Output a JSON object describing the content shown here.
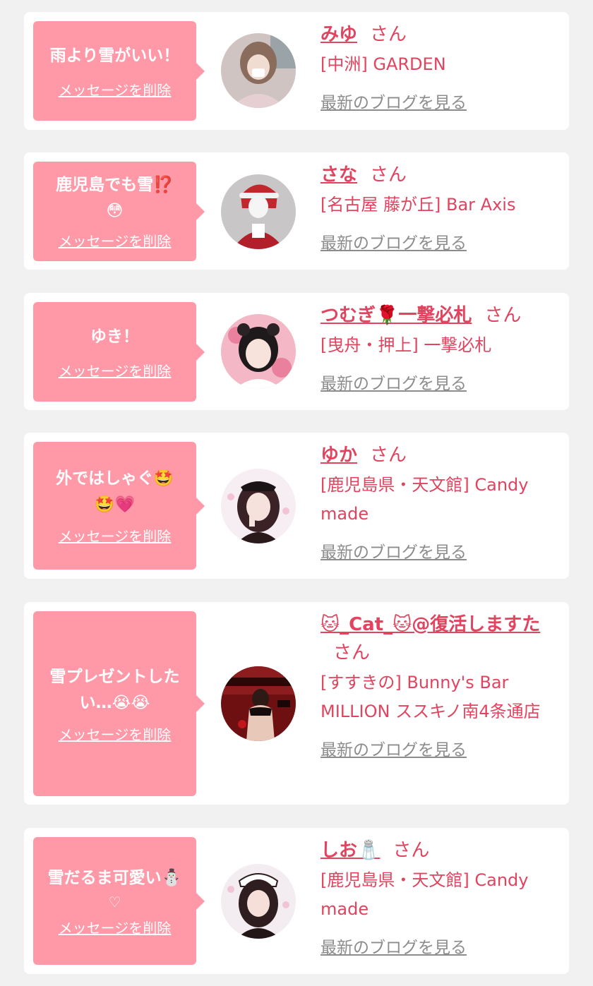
{
  "delete_label": "メッセージを削除",
  "blog_label": "最新のブログを見る",
  "san_suffix": "さん",
  "colors": {
    "background": "#f1f1f1",
    "card": "#ffffff",
    "bubble": "#ff99a8",
    "accent": "#e0445f",
    "link_gray": "#8c8c8c"
  },
  "messages": [
    {
      "message": "雨より雪がいい！",
      "name": "みゆ",
      "shop": "[中洲] GARDEN"
    },
    {
      "message": "鹿児島でも雪⁉️\n😳",
      "name": "さな",
      "shop": "[名古屋 藤が丘] Bar Axis"
    },
    {
      "message": "ゆき！",
      "name": "つむぎ🌹一撃必札",
      "shop": "[曳舟・押上] 一撃必札"
    },
    {
      "message": "外ではしゃぐ🤩\n🤩💗",
      "name": "ゆか",
      "shop": "[鹿児島県・天文館] Candy made"
    },
    {
      "message": "雪プレゼントした\nい…😭😭",
      "name": "🐱_Cat_🐱@復活しますた",
      "shop": "[すすきの] Bunny's Bar MILLION ススキノ南4条通店"
    },
    {
      "message": "雪だるま可愛い⛄",
      "heart": "♡",
      "name": "しお🧂",
      "shop": "[鹿児島県・天文館] Candy made"
    }
  ]
}
